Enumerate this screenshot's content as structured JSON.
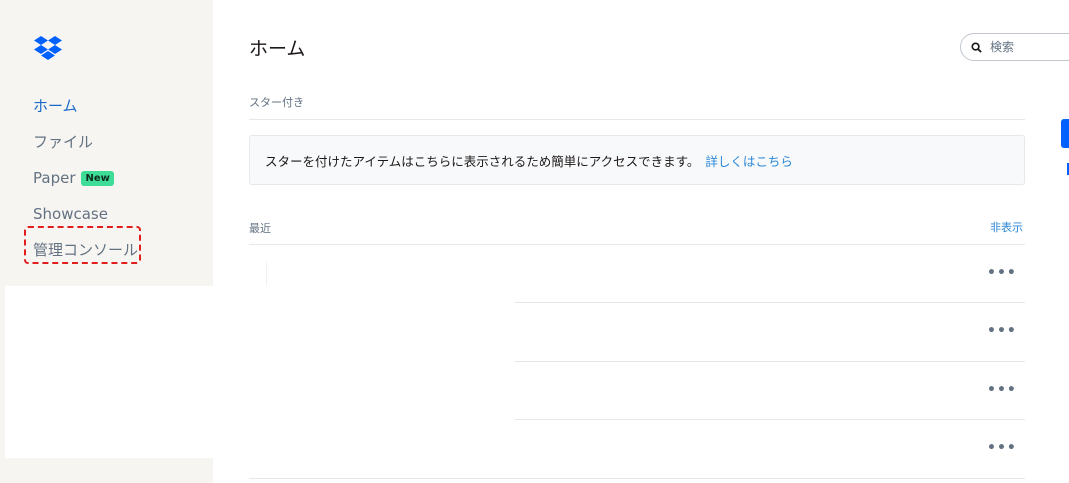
{
  "sidebar": {
    "logo": "dropbox-logo",
    "items": [
      {
        "label": "ホーム",
        "active": true
      },
      {
        "label": "ファイル"
      },
      {
        "label": "Paper",
        "badge": "New"
      },
      {
        "label": "Showcase"
      },
      {
        "label": "管理コンソール",
        "highlighted": true
      }
    ]
  },
  "header": {
    "title": "ホーム",
    "search": {
      "placeholder": "検索",
      "icon": "search-icon"
    }
  },
  "starred": {
    "label": "スター付き",
    "message": "スターを付けたアイテムはこちらに表示されるため簡単にアクセスできます。",
    "link": "詳しくはこちら"
  },
  "recent": {
    "label": "最近",
    "hide_label": "非表示",
    "rows": [
      {
        "more": "•••"
      },
      {
        "more": "•••"
      },
      {
        "more": "•••"
      },
      {
        "more": "•••"
      }
    ]
  },
  "colors": {
    "accent": "#0061fe",
    "link": "#2b87d8",
    "highlight": "#e01e1e",
    "badge": "#3ddc97"
  }
}
